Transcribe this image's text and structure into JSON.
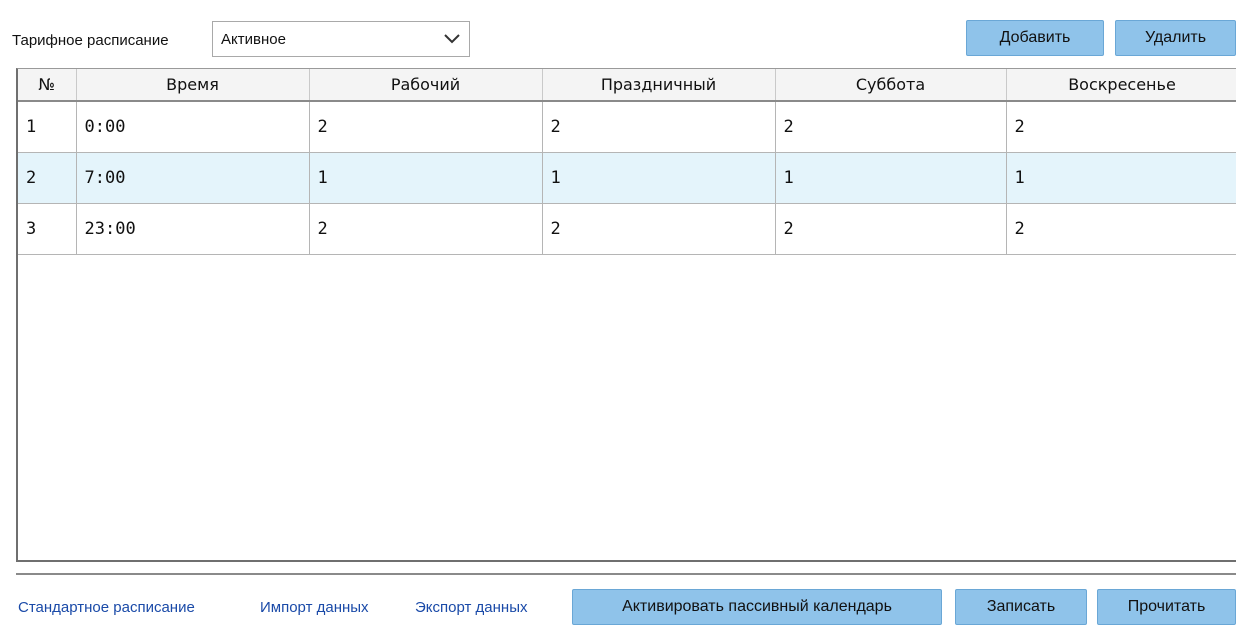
{
  "toolbar": {
    "schedule_label": "Тарифное расписание",
    "schedule_value": "Активное",
    "add_label": "Добавить",
    "delete_label": "Удалить"
  },
  "table": {
    "columns": [
      "№",
      "Время",
      "Рабочий",
      "Праздничный",
      "Суббота",
      "Воскресенье"
    ],
    "rows": [
      [
        "1",
        "0:00",
        "2",
        "2",
        "2",
        "2"
      ],
      [
        "2",
        "7:00",
        "1",
        "1",
        "1",
        "1"
      ],
      [
        "3",
        "23:00",
        "2",
        "2",
        "2",
        "2"
      ]
    ]
  },
  "footer": {
    "link_standard": "Стандартное расписание",
    "link_import": "Импорт данных",
    "link_export": "Экспорт данных",
    "activate_label": "Активировать пассивный календарь",
    "write_label": "Записать",
    "read_label": "Прочитать"
  },
  "colors": {
    "button_bg": "#8fc3ea",
    "selected_row": "#e4f4fb",
    "link": "#1a4aa8"
  }
}
